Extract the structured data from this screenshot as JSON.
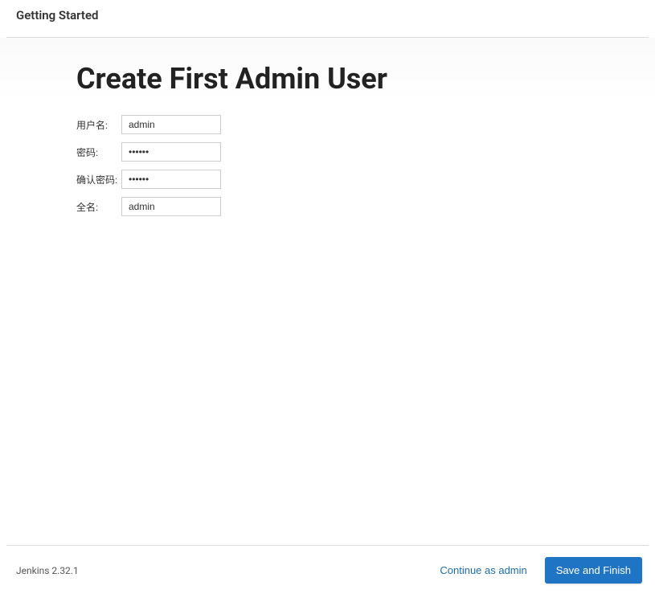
{
  "header": {
    "title": "Getting Started"
  },
  "main": {
    "title": "Create First Admin User",
    "form": {
      "username": {
        "label": "用户名:",
        "value": "admin"
      },
      "password": {
        "label": "密码:",
        "value": "••••••"
      },
      "confirm_password": {
        "label": "确认密码:",
        "value": "••••••"
      },
      "fullname": {
        "label": "全名:",
        "value": "admin"
      }
    }
  },
  "footer": {
    "version": "Jenkins 2.32.1",
    "continue_label": "Continue as admin",
    "save_label": "Save and Finish"
  }
}
